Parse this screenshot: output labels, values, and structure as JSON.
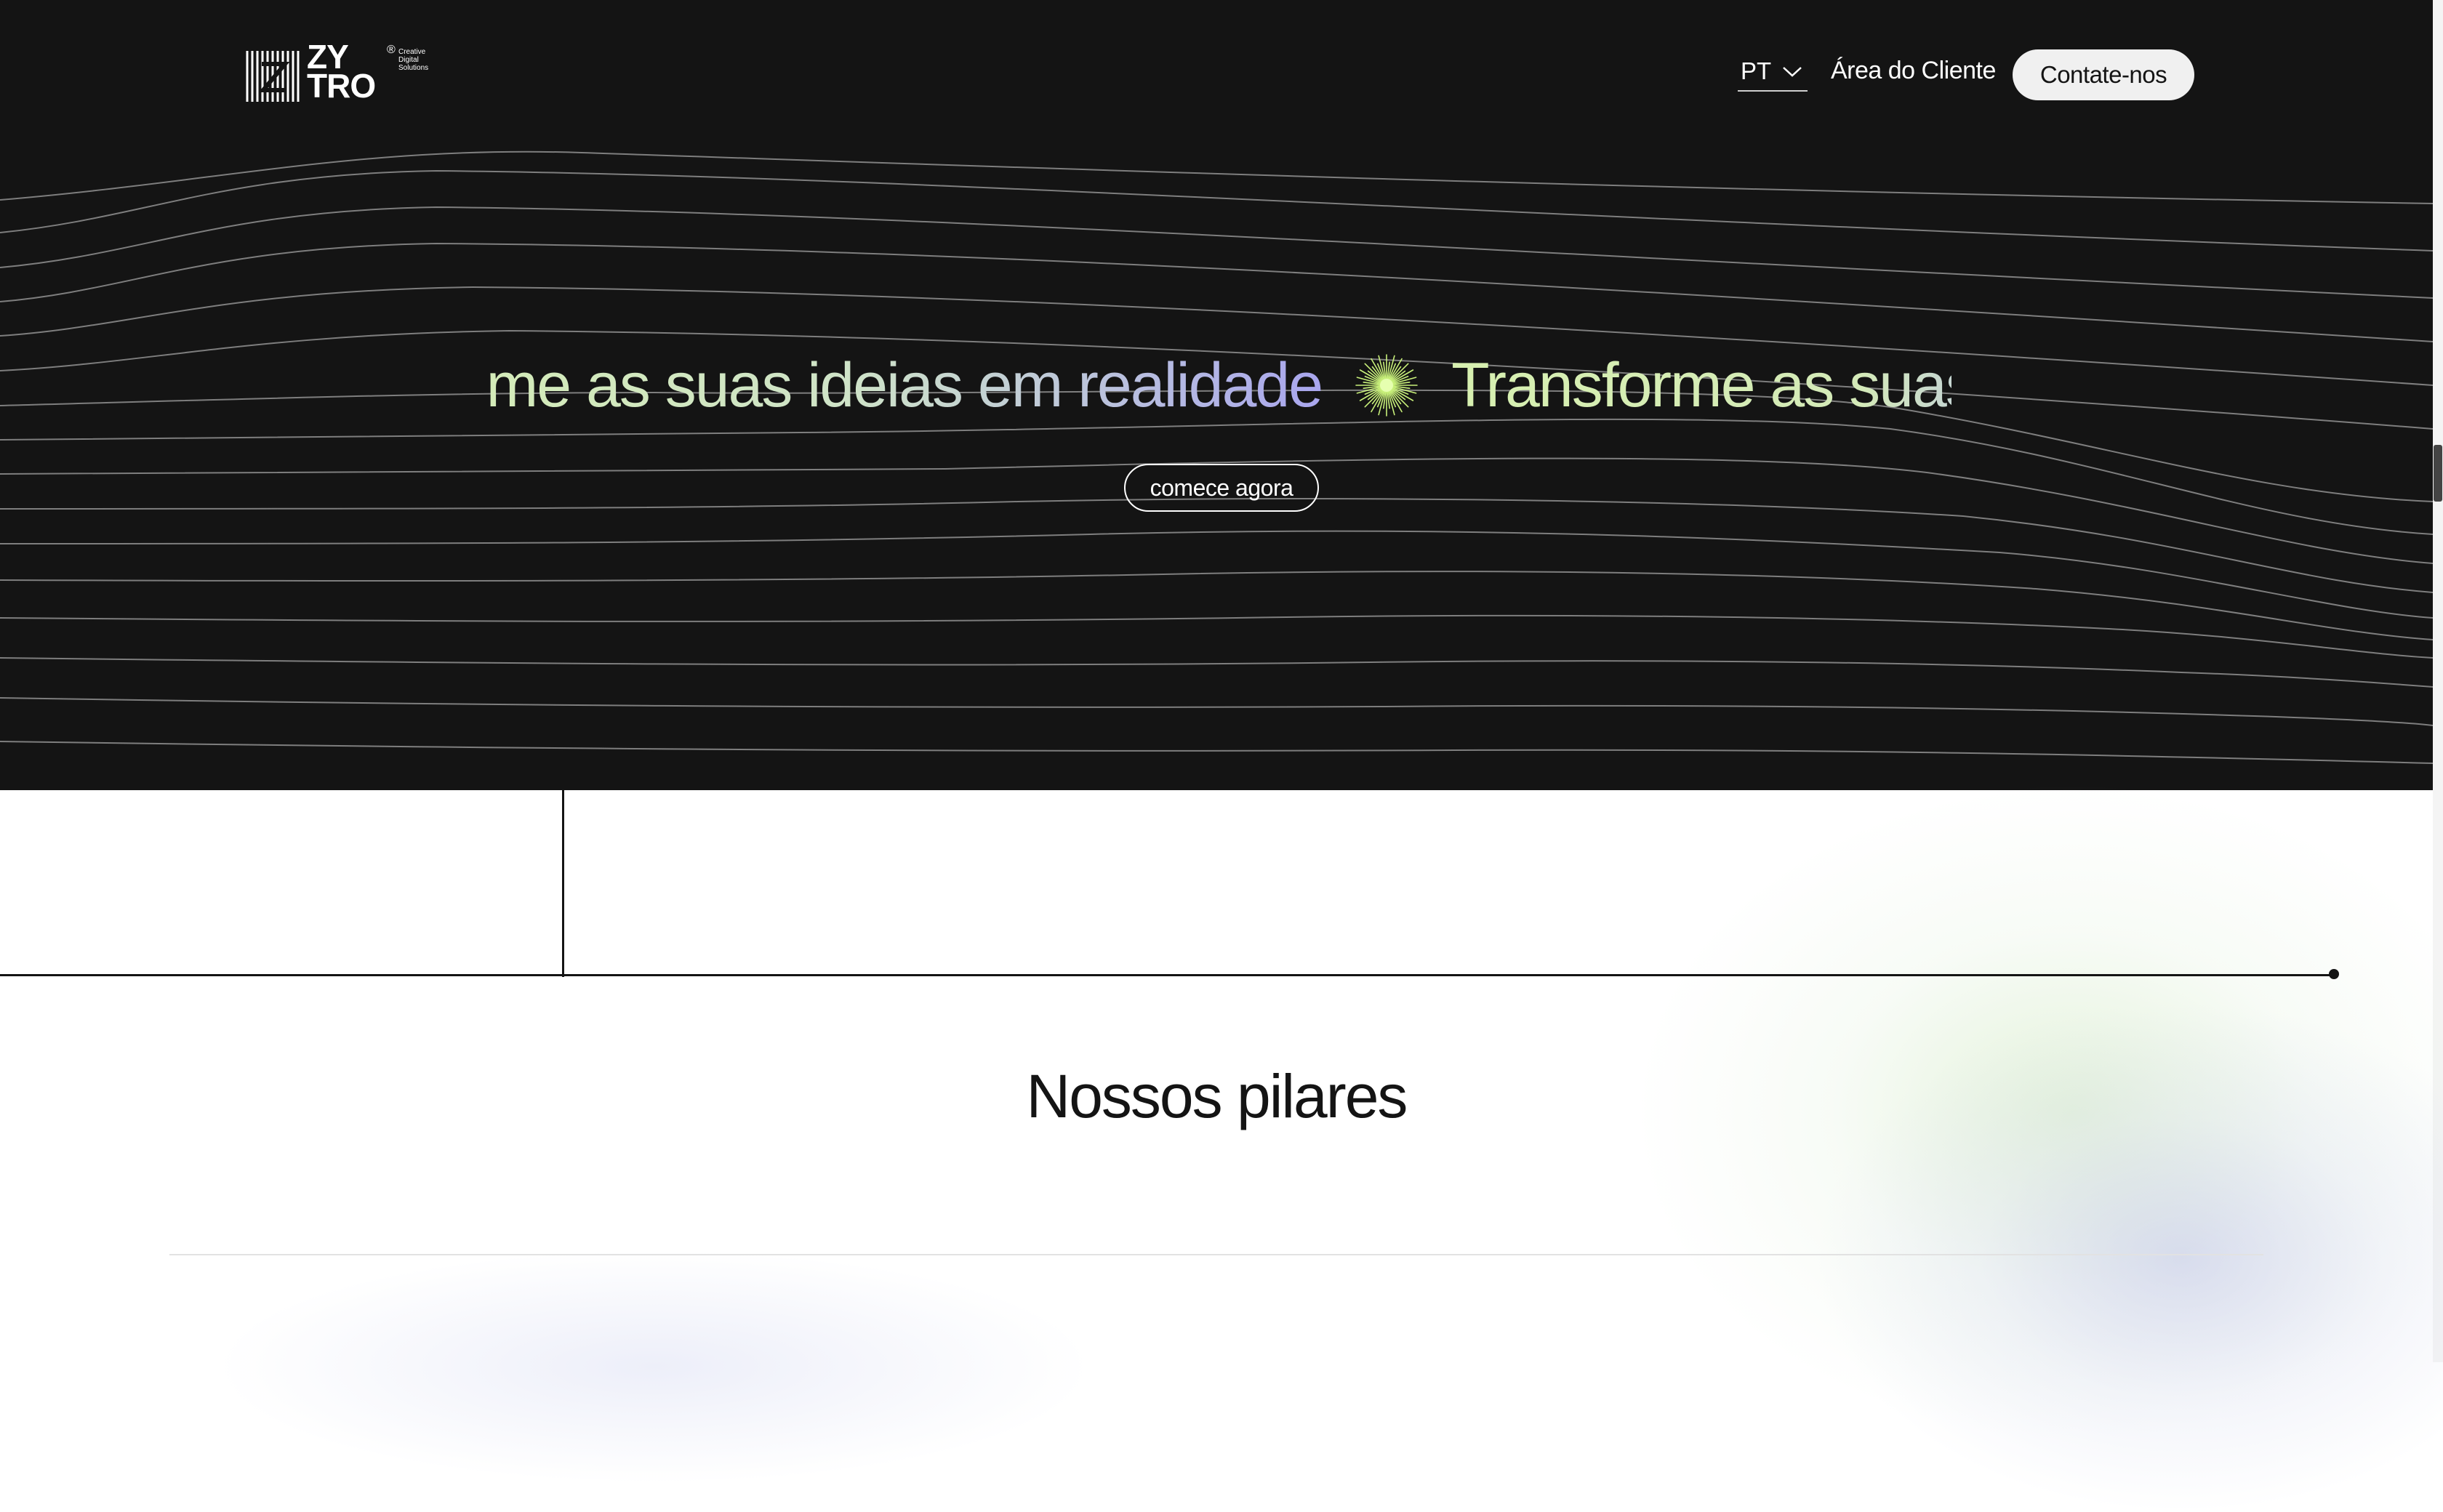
{
  "header": {
    "logo": {
      "word_top": "ZY",
      "word_bottom": "TRO",
      "registered": "®",
      "tagline": [
        "Creative",
        "Digital",
        "Solutions"
      ]
    },
    "language": {
      "selected": "PT",
      "icon": "chevron-down-icon"
    },
    "client_area_label": "Área do Cliente",
    "contact_label": "Contate-nos"
  },
  "hero": {
    "marquee_text_1": "·me as suas ideias em realidade",
    "marquee_text_2": "Transforme as suas ic",
    "separator_icon": "sparkle-burst-icon",
    "cta_label": "comece agora"
  },
  "pillars": {
    "title": "Nossos pilares"
  },
  "colors": {
    "hero_background": "#141414",
    "page_background": "#ffffff",
    "gradient_green": "#d4ecb8",
    "gradient_purple": "#a9a6ee",
    "burst_color": "#c8f07a"
  }
}
